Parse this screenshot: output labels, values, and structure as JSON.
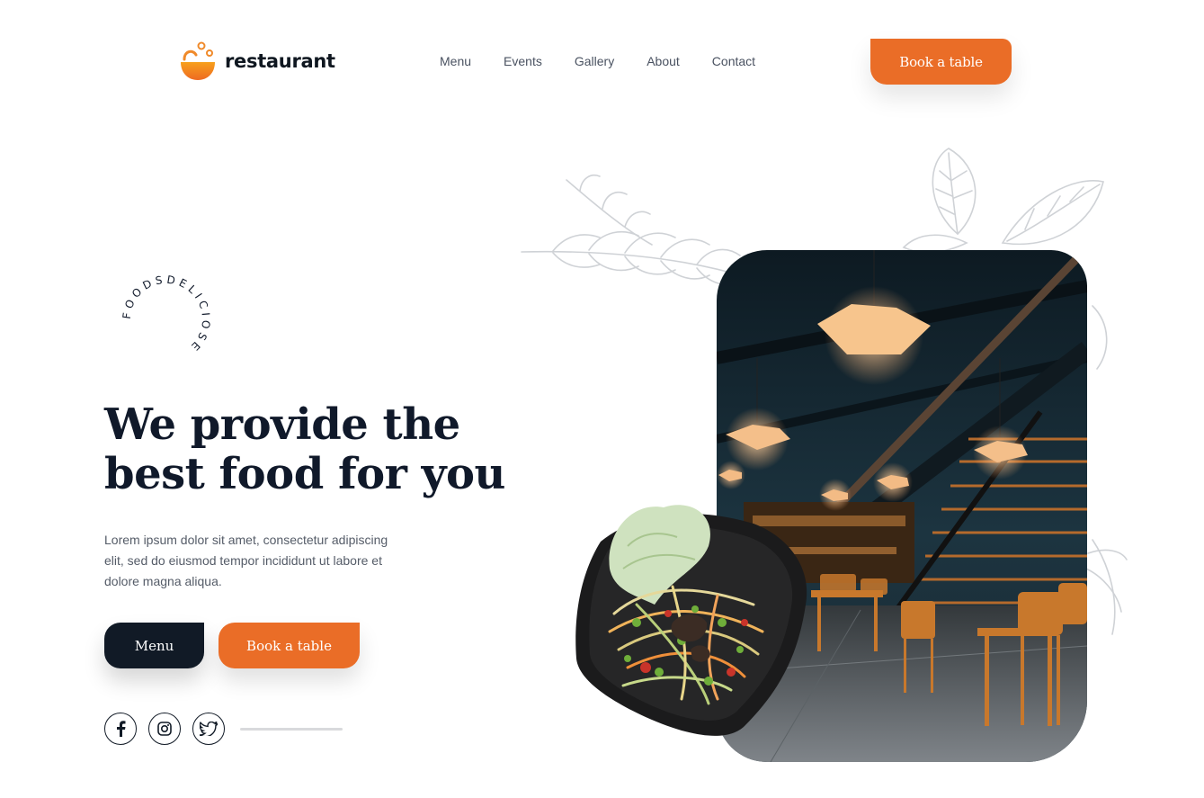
{
  "brand": {
    "name": "restaurant",
    "accent": "#ea6d27",
    "dark": "#111a26"
  },
  "nav": {
    "items": [
      "Menu",
      "Events",
      "Gallery",
      "About",
      "Contact"
    ]
  },
  "header": {
    "cta_label": "Book a table"
  },
  "badge": {
    "text": "FOODSDELICIOSE"
  },
  "hero": {
    "title": "We provide the best food for you",
    "description": "Lorem ipsum dolor sit amet, consectetur adipiscing elit, sed do eiusmod tempor incididunt ut labore et dolore magna aliqua.",
    "menu_label": "Menu",
    "book_label": "Book a table"
  },
  "socials": [
    {
      "icon": "facebook-icon"
    },
    {
      "icon": "instagram-icon"
    },
    {
      "icon": "twitter-icon"
    }
  ]
}
